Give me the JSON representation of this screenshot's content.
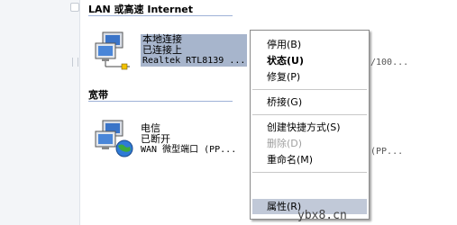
{
  "groups": {
    "lan_header": "LAN 或高速 Internet",
    "broadband_header": "宽带"
  },
  "connections": {
    "lan": {
      "name": "本地连接",
      "status": "已连接上",
      "device": "Realtek RTL8139 ...",
      "tail": "/100..."
    },
    "dialup": {
      "name": "电信",
      "status": "已断开",
      "device": "WAN 微型端口 (PP...",
      "tail": "(PP..."
    }
  },
  "context_menu": {
    "disable": "停用(B)",
    "status": "状态(U)",
    "repair": "修复(P)",
    "bridge": "桥接(G)",
    "create_shortcut": "创建快捷方式(S)",
    "delete": "删除(D)",
    "rename": "重命名(M)",
    "properties": "属性(R)"
  },
  "watermark": "ybx8.cn",
  "colors": {
    "selection": "#a7b5cc",
    "menu_highlight": "#c1c9d8",
    "group_rule": "#9fb2d7"
  },
  "icons": {
    "lan": "network-computers-icon",
    "dialup": "dialup-globe-icon"
  }
}
